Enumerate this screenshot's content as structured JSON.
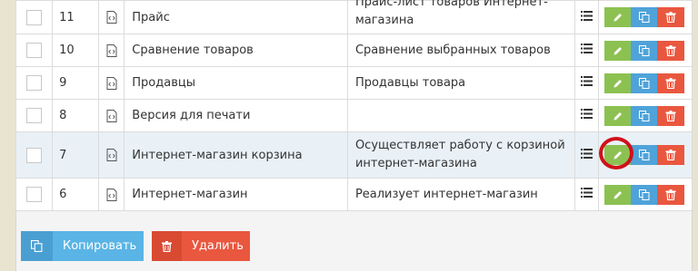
{
  "table": {
    "rows": [
      {
        "num": "11",
        "name": "Прайс",
        "desc": "Прайс-лист товаров Интернет-магазина"
      },
      {
        "num": "10",
        "name": "Сравнение товаров",
        "desc": "Сравнение выбранных товаров"
      },
      {
        "num": "9",
        "name": "Продавцы",
        "desc": "Продавцы товара"
      },
      {
        "num": "8",
        "name": "Версия для печати",
        "desc": ""
      },
      {
        "num": "7",
        "name": "Интернет-магазин корзина",
        "desc": "Осуществляет работу с корзиной интернет-магазина"
      },
      {
        "num": "6",
        "name": "Интернет-магазин",
        "desc": "Реализует интернет-магазин"
      }
    ]
  },
  "footer": {
    "copy_label": "Копировать",
    "delete_label": "Удалить"
  },
  "colors": {
    "edit": "#8cc152",
    "copy": "#4fa3d9",
    "delete": "#e9573f",
    "highlight_ring": "#d0101a"
  },
  "icons": {
    "row_file": "document-code-icon",
    "row_list": "list-icon",
    "edit": "pencil-icon",
    "copy": "copy-icon",
    "delete": "trash-icon"
  }
}
